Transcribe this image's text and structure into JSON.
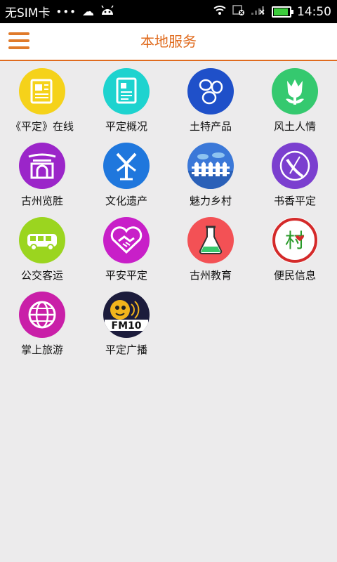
{
  "status": {
    "carrier": "无SIM卡",
    "dots": "•••",
    "time": "14:50"
  },
  "header": {
    "title": "本地服务"
  },
  "services": [
    {
      "label": "《平定》在线",
      "icon": "newspaper-icon",
      "color": "#f5d21a"
    },
    {
      "label": "平定概况",
      "icon": "document-icon",
      "color": "#1ed3cf"
    },
    {
      "label": "土特产品",
      "icon": "beans-icon",
      "color": "#1f50c9"
    },
    {
      "label": "风土人情",
      "icon": "flower-icon",
      "color": "#35c96f"
    },
    {
      "label": "古州览胜",
      "icon": "gate-icon",
      "color": "#9b25c9"
    },
    {
      "label": "文化遗产",
      "icon": "heritage-icon",
      "color": "#1f77dd"
    },
    {
      "label": "魅力乡村",
      "icon": "fence-icon",
      "color": "#3b78d8"
    },
    {
      "label": "书香平定",
      "icon": "brush-icon",
      "color": "#7b3fcf"
    },
    {
      "label": "公交客运",
      "icon": "bus-icon",
      "color": "#9bd51f"
    },
    {
      "label": "平安平定",
      "icon": "handshake-icon",
      "color": "#c81fc8"
    },
    {
      "label": "古州教育",
      "icon": "flask-icon",
      "color": "#f35155"
    },
    {
      "label": "便民信息",
      "icon": "village-seal-icon",
      "color": "#ffffff"
    },
    {
      "label": "掌上旅游",
      "icon": "globe-icon",
      "color": "#c91fa8"
    },
    {
      "label": "平定广播",
      "icon": "fm-radio-icon",
      "color": "#1c1c3c"
    }
  ],
  "badges": {
    "fm": "FM10",
    "seal": "村"
  }
}
